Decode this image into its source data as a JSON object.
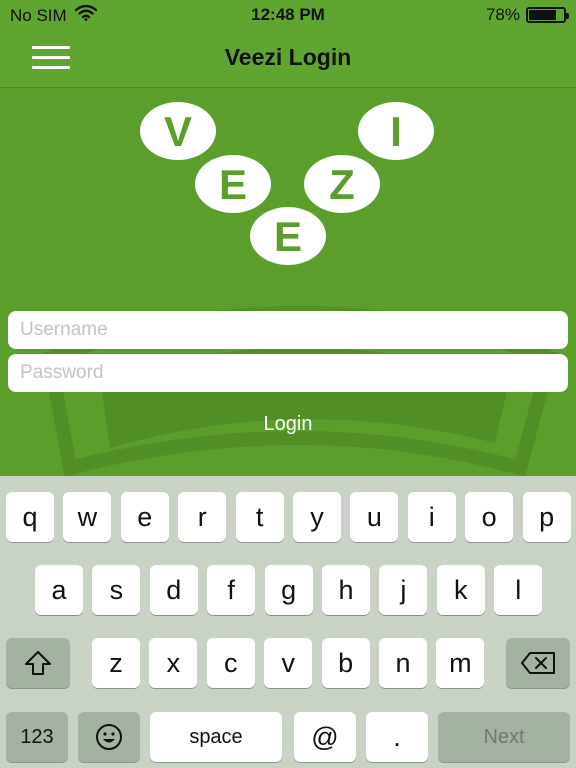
{
  "status_bar": {
    "carrier": "No SIM",
    "time": "12:48 PM",
    "battery_percent": "78%",
    "battery_level": 0.78
  },
  "nav": {
    "title": "Veezi Login"
  },
  "logo": {
    "letters": [
      "V",
      "E",
      "E",
      "Z",
      "I"
    ]
  },
  "form": {
    "username_placeholder": "Username",
    "password_placeholder": "Password",
    "login_label": "Login"
  },
  "keyboard": {
    "row1": [
      "q",
      "w",
      "e",
      "r",
      "t",
      "y",
      "u",
      "i",
      "o",
      "p"
    ],
    "row2": [
      "a",
      "s",
      "d",
      "f",
      "g",
      "h",
      "j",
      "k",
      "l"
    ],
    "row3": [
      "z",
      "x",
      "c",
      "v",
      "b",
      "n",
      "m"
    ],
    "numbers_label": "123",
    "space_label": "space",
    "at_label": "@",
    "dot_label": ".",
    "next_label": "Next"
  },
  "colors": {
    "brand_green": "#60a52f",
    "keyboard_bg": "#c8d3c6"
  }
}
